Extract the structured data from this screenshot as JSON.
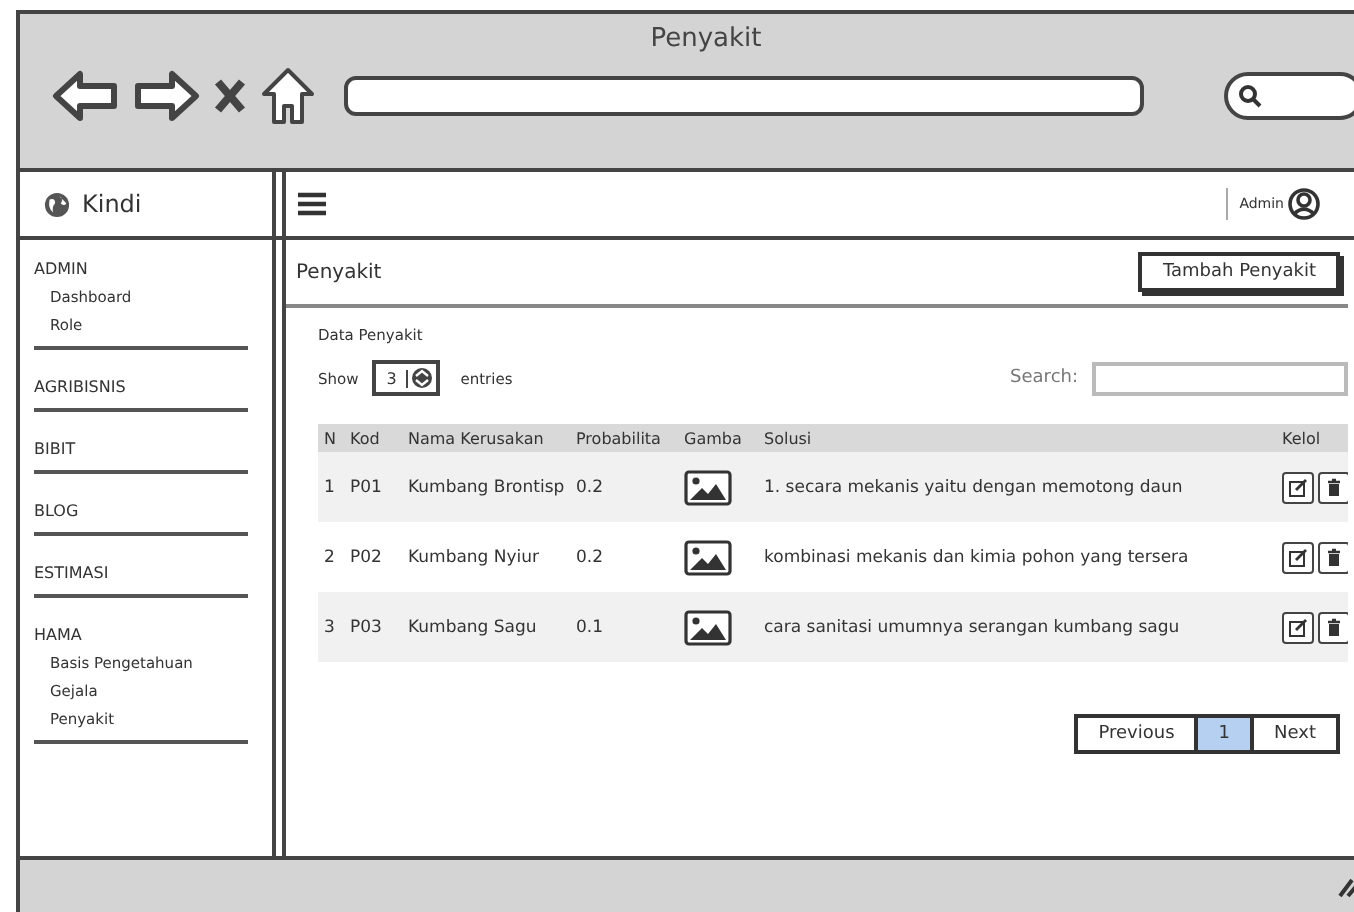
{
  "window": {
    "title": "Penyakit"
  },
  "brand": {
    "label": "Kindi"
  },
  "navbar": {
    "user": "Admin"
  },
  "sidebar": {
    "sections": [
      {
        "title": "ADMIN",
        "items": [
          "Dashboard",
          "Role"
        ]
      },
      {
        "title": "AGRIBISNIS"
      },
      {
        "title": "BIBIT"
      },
      {
        "title": "BLOG"
      },
      {
        "title": "ESTIMASI"
      },
      {
        "title": "HAMA",
        "items": [
          "Basis Pengetahuan",
          "Gejala",
          "Penyakit"
        ]
      }
    ]
  },
  "page": {
    "title": "Penyakit",
    "add_button": "Tambah Penyakit"
  },
  "panel": {
    "title": "Data Penyakit",
    "show_label": "Show",
    "entries_value": "3",
    "entries_label": "entries",
    "search_label": "Search:"
  },
  "table": {
    "columns": [
      "N",
      "Kod",
      "Nama Kerusakan",
      "Probabilita",
      "Gamba",
      "Solusi",
      "Kelol"
    ],
    "rows": [
      {
        "no": "1",
        "kode": "P01",
        "nama": "Kumbang Brontisp",
        "probabilitas": "0.2",
        "solusi": "1. secara mekanis yaitu dengan memotong daun"
      },
      {
        "no": "2",
        "kode": "P02",
        "nama": "Kumbang Nyiur",
        "probabilitas": "0.2",
        "solusi": "kombinasi mekanis dan kimia pohon yang tersera"
      },
      {
        "no": "3",
        "kode": "P03",
        "nama": "Kumbang Sagu",
        "probabilitas": "0.1",
        "solusi": "cara sanitasi umumnya serangan kumbang sagu"
      }
    ]
  },
  "pagination": {
    "previous": "Previous",
    "pages": [
      {
        "label": "1",
        "selected": true
      }
    ],
    "next": "Next"
  }
}
